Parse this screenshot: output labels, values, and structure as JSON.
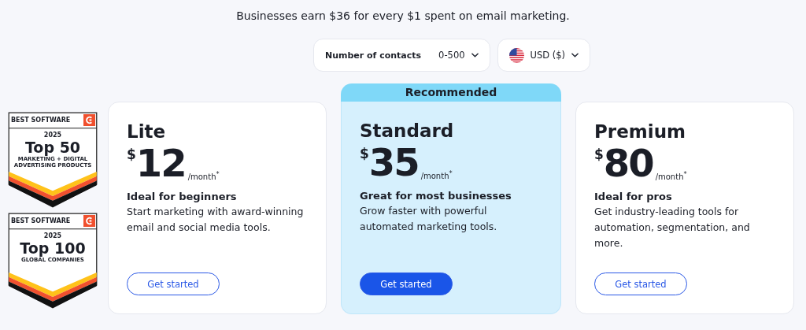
{
  "headline": "Businesses earn $36 for every $1 spent on email marketing.",
  "selectors": [
    {
      "kind": "contacts",
      "label": "Number of contacts",
      "value": "0-500"
    },
    {
      "kind": "currency",
      "value": "USD ($)"
    }
  ],
  "badges": [
    {
      "top": "BEST SOFTWARE",
      "year": "2025",
      "title": "Top 50",
      "caption": "MARKETING + DIGITAL ADVERTISING PRODUCTS"
    },
    {
      "top": "BEST SOFTWARE",
      "year": "2025",
      "title": "Top 100",
      "caption": "GLOBAL COMPANIES"
    }
  ],
  "plans": [
    {
      "name": "Lite",
      "currency": "$",
      "price": "12",
      "period": "/month$^{*}$",
      "tagline": "Ideal for beginners",
      "description": "Start marketing with award-winning email and social media tools.",
      "button": "Get started",
      "highlighted": false
    },
    {
      "name": "Standard",
      "ribbon": "Recommended",
      "currency": "$",
      "price": "35",
      "period": "/month$^{*}$",
      "tagline": "Great for most businesses",
      "description": "Grow faster with powerful automated marketing tools.",
      "button": "Get started",
      "highlighted": true
    },
    {
      "name": "Premium",
      "currency": "$",
      "price": "80",
      "period": "/month$^{*}$",
      "tagline": "Ideal for pros",
      "description": "Get industry-leading tools for automation, segmentation, and more.",
      "button": "Get started",
      "highlighted": false
    }
  ]
}
